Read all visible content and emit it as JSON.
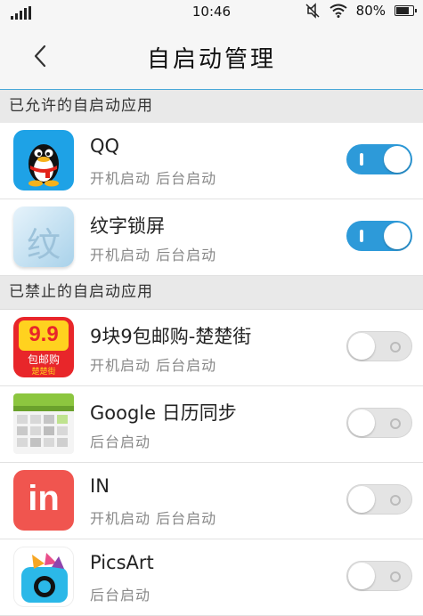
{
  "status_bar": {
    "time": "10:46",
    "battery": "80%",
    "battery_level": 0.8
  },
  "header": {
    "title": "自启动管理"
  },
  "sections": {
    "allowed": {
      "title": "已允许的自启动应用"
    },
    "forbidden": {
      "title": "已禁止的自启动应用"
    }
  },
  "apps": [
    {
      "name": "QQ",
      "sub": "开机启动  后台启动",
      "enabled": true,
      "icon": "qq-penguin-icon"
    },
    {
      "name": "纹字锁屏",
      "sub": "开机启动  后台启动",
      "enabled": true,
      "icon": "wenzi-lockscreen-icon",
      "icon_glyph": "纹"
    },
    {
      "name": "9块9包邮购-楚楚街",
      "sub": "开机启动  后台启动",
      "enabled": false,
      "icon": "chuchujie-icon",
      "icon_text": "9.9",
      "icon_text2": "包邮购",
      "icon_text3": "楚楚街"
    },
    {
      "name": "Google 日历同步",
      "sub": "后台启动",
      "enabled": false,
      "icon": "google-calendar-sync-icon"
    },
    {
      "name": "IN",
      "sub": "开机启动  后台启动",
      "enabled": false,
      "icon": "in-app-icon",
      "icon_text": "in"
    },
    {
      "name": "PicsArt",
      "sub": "后台启动",
      "enabled": false,
      "icon": "picsart-icon"
    }
  ],
  "colors": {
    "accent": "#2d9ad9",
    "qq_bg": "#1ea2e6",
    "in_bg": "#f0554f",
    "chuchu_bg": "#e8262a"
  }
}
